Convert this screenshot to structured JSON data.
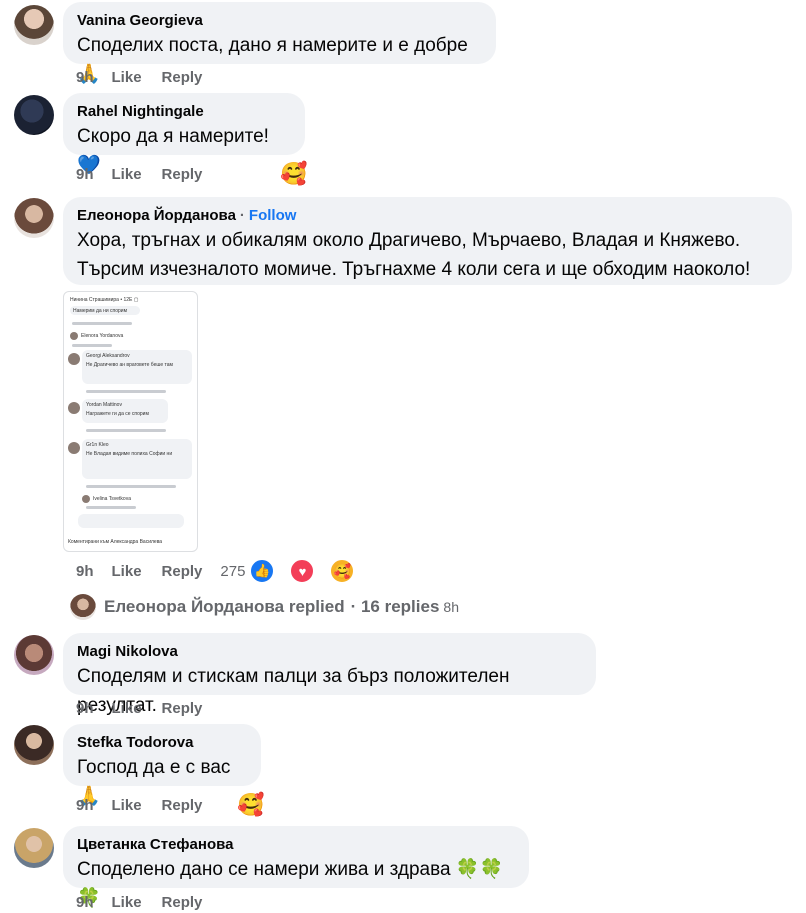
{
  "labels": {
    "like": "Like",
    "reply": "Reply"
  },
  "comments": [
    {
      "author": "Vanina Georgieva",
      "text": "Споделих поста, дано я намерите и е добре 🙏",
      "time": "9h"
    },
    {
      "author": "Rahel Nightingale",
      "text": "Скоро да я намерите! 💙",
      "time": "9h",
      "reaction": "🥰"
    },
    {
      "author": "Елеонора Йорданова",
      "follow": "Follow",
      "dot": "·",
      "text_line1": "Хора, тръгнах и обикалям около Драгичево, Мърчаево, Владая и Княжево.",
      "text_line2": "Търсим изчезналото момиче. Тръгнахме 4 коли сега и ще обходим наоколо!",
      "time": "9h",
      "reaction_count": "275",
      "reaction_icons": [
        "like-icon",
        "heart-icon",
        "care-icon"
      ],
      "replies_author": "Елеонора Йорданова replied",
      "replies_count": "· 16 replies",
      "replies_time": "8h"
    },
    {
      "author": "Magi Nikolova",
      "text": "Споделям и стискам палци за бърз положителен резултат.",
      "time": "9h"
    },
    {
      "author": "Stefka Todorova",
      "text": "Господ да е с вас🙏",
      "time": "9h",
      "reaction": "🥰"
    },
    {
      "author": "Цветанка Стефанова",
      "text": "Споделено дано се намери жива и здрава 🍀🍀🍀",
      "time": "9h"
    }
  ],
  "screenshot_thumb": {
    "lines": [
      "Нинина Страшимира • 12Е ▢",
      "Намерим да ни спорим",
      "Elenora Yordanova",
      "Georgi Aleksandrov",
      "Не Драгичево  ан враговете беше там",
      "Yordan Mattinov",
      "Награжете ги да се спорим",
      "Gr1n Kleo",
      "Не Владая видиме полиха Софии ни",
      "Ivelina Tsvetkova",
      "Коментирани към Александра Василева"
    ]
  }
}
